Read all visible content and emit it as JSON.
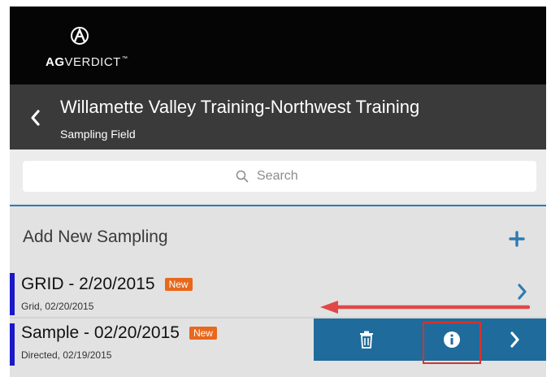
{
  "app": {
    "brand_strong": "AG",
    "brand_light": "VERDICT",
    "brand_tm": "™"
  },
  "header": {
    "title": "Willamette Valley Training-Northwest Training",
    "subtitle": "Sampling Field"
  },
  "search": {
    "placeholder": "Search"
  },
  "add_new": {
    "label": "Add New Sampling"
  },
  "samplings": [
    {
      "title": "GRID - 2/20/2015",
      "badge": "New",
      "subtitle": "Grid, 02/20/2015"
    },
    {
      "title": "Sample - 02/20/2015",
      "badge": "New",
      "subtitle": "Directed, 02/19/2015"
    }
  ],
  "swipe_actions": [
    "trash-icon",
    "info-icon",
    "chevron-right-icon"
  ],
  "colors": {
    "top_bar": "#050505",
    "title_bar": "#3a3a3a",
    "accent_blue": "#2e7bb3",
    "action_blue": "#1f6b9c",
    "badge_orange": "#e8681c",
    "row_marker": "#1a18c8",
    "annotation_red": "#d8332a"
  }
}
